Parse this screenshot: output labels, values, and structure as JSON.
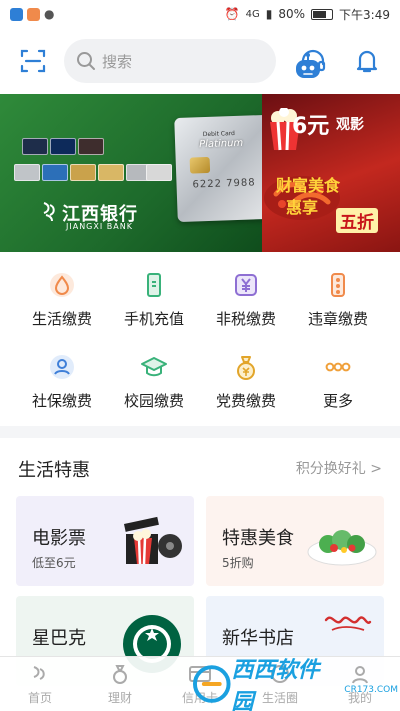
{
  "status_bar": {
    "battery": "80%",
    "time": "下午3:49",
    "network": "4G"
  },
  "header": {
    "search_placeholder": "搜索"
  },
  "banner": {
    "bank_name_cn": "江西银行",
    "bank_name_en": "JIANGXI BANK",
    "card_type": "Platinum",
    "card_label": "Debit Card",
    "card_number": "6222 7988",
    "promo_price": "6元",
    "promo_movie": "观影",
    "promo_food_line1": "财富美食",
    "promo_food_line2": "惠享",
    "promo_discount": "五折"
  },
  "services": [
    {
      "label": "生活缴费",
      "icon": "drop-icon",
      "color": "#f08a4b"
    },
    {
      "label": "手机充值",
      "icon": "phone-icon",
      "color": "#39b27a"
    },
    {
      "label": "非税缴费",
      "icon": "yen-icon",
      "color": "#8e6fd3"
    },
    {
      "label": "违章缴费",
      "icon": "traffic-light-icon",
      "color": "#f08a4b"
    },
    {
      "label": "社保缴费",
      "icon": "shield-person-icon",
      "color": "#3f7fd8"
    },
    {
      "label": "校园缴费",
      "icon": "graduation-icon",
      "color": "#39b27a"
    },
    {
      "label": "党费缴费",
      "icon": "money-bag-icon",
      "color": "#e2a52a"
    },
    {
      "label": "更多",
      "icon": "more-icon",
      "color": "#f0a03a"
    }
  ],
  "deals": {
    "title": "生活特惠",
    "more": "积分换好礼 >",
    "items": [
      {
        "name": "电影票",
        "sub": "低至6元",
        "bg": "#f1effa"
      },
      {
        "name": "特惠美食",
        "sub": "5折购",
        "bg": "#fdf3ef"
      },
      {
        "name": "星巴克",
        "sub": "",
        "bg": "#eef5f1"
      },
      {
        "name": "新华书店",
        "sub": "",
        "bg": "#eef3fb"
      }
    ]
  },
  "bottom_nav": [
    {
      "label": "首页"
    },
    {
      "label": "理财"
    },
    {
      "label": "信用卡"
    },
    {
      "label": "生活圈"
    },
    {
      "label": "我的"
    }
  ],
  "watermark": {
    "text": "西西软件园",
    "url": "CR173.COM"
  },
  "colors": {
    "accent": "#2e7fd6",
    "bank_green": "#1d6a2b",
    "promo_red": "#c8151b"
  }
}
